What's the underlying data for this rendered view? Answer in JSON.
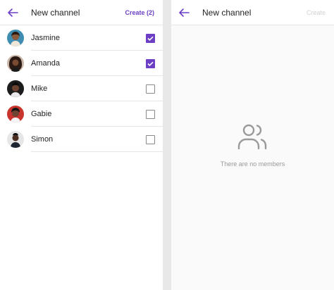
{
  "colors": {
    "accent": "#6c3fc5",
    "disabled": "#d2d2d2"
  },
  "left": {
    "title": "New channel",
    "back_icon": "arrow-left-icon",
    "create_label": "Create (2)",
    "contacts": [
      {
        "name": "Jasmine",
        "checked": true
      },
      {
        "name": "Amanda",
        "checked": true
      },
      {
        "name": "Mike",
        "checked": false
      },
      {
        "name": "Gabie",
        "checked": false
      },
      {
        "name": "Simon",
        "checked": false
      }
    ]
  },
  "right": {
    "title": "New channel",
    "back_icon": "arrow-left-icon",
    "create_label": "Create",
    "empty_icon": "users-icon",
    "empty_text": "There are no members"
  }
}
